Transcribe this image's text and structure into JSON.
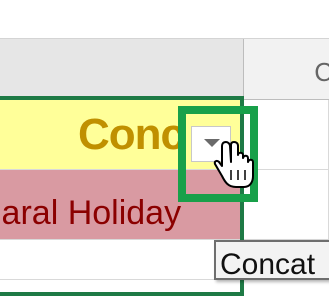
{
  "column_header_right_letter": "C",
  "table": {
    "header_cell": "Conc",
    "data_cell": "laral Holiday",
    "next_row_cell": ""
  },
  "filter_button": {
    "icon": "dropdown-arrow-icon"
  },
  "tooltip": {
    "text": "Concat"
  },
  "colors": {
    "header_fill": "#ffff99",
    "header_text": "#c09000",
    "data_fill": "#d99aa2",
    "data_text": "#8b0000",
    "table_border": "#1e7a45",
    "highlight_box": "#18a04a"
  }
}
